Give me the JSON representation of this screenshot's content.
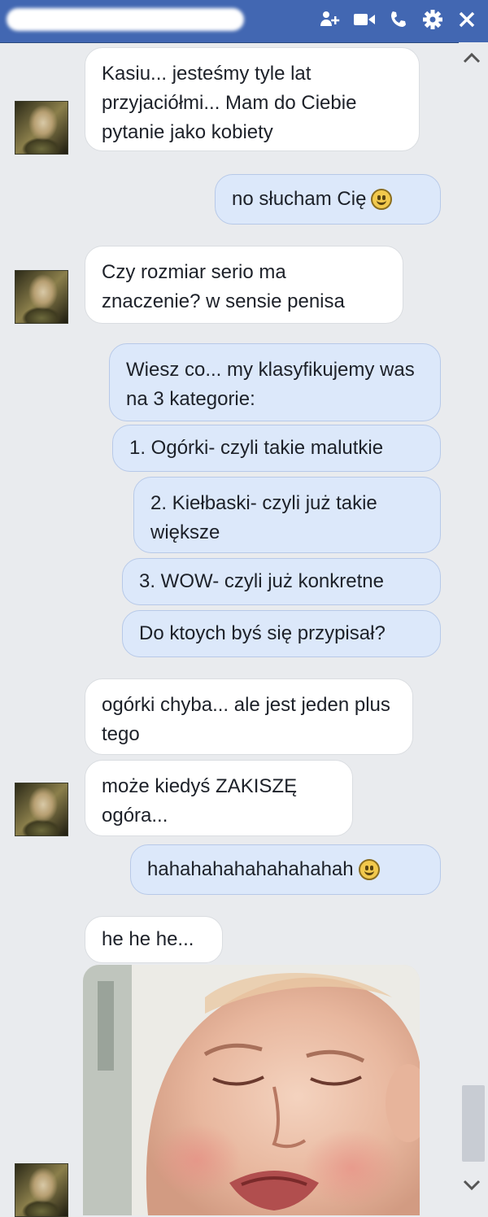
{
  "header": {
    "icons": [
      "add-people-icon",
      "video-call-icon",
      "phone-icon",
      "gear-icon",
      "close-icon"
    ]
  },
  "messages": [
    {
      "from": "them",
      "text": "Kasiu... jesteśmy tyle lat przyjaciółmi... Mam do Ciebie pytanie jako kobiety"
    },
    {
      "from": "me",
      "text": "no słucham Cię",
      "emoji": "smiley-icon"
    },
    {
      "from": "them",
      "text": "Czy rozmiar serio ma znaczenie? w sensie penisa"
    },
    {
      "from": "me",
      "text": "Wiesz co... my klasyfikujemy was na 3 kategorie:"
    },
    {
      "from": "me",
      "text": "1. Ogórki- czyli takie malutkie"
    },
    {
      "from": "me",
      "text": "2. Kiełbaski- czyli już takie większe"
    },
    {
      "from": "me",
      "text": "3. WOW- czyli już konkretne"
    },
    {
      "from": "me",
      "text": "Do ktoych byś się przypisał?"
    },
    {
      "from": "them",
      "text": "ogórki chyba... ale jest jeden plus tego"
    },
    {
      "from": "them",
      "text": "może kiedyś ZAKISZĘ ogóra..."
    },
    {
      "from": "me",
      "text": "hahahahahahahahahah",
      "emoji": "smiley-icon"
    },
    {
      "from": "them",
      "text": "he he he..."
    },
    {
      "from": "them",
      "image": "crying-baby-photo"
    }
  ]
}
